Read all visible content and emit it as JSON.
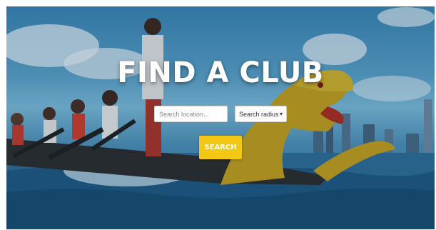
{
  "hero": {
    "title": "FIND A CLUB",
    "location_placeholder": "Search location...",
    "radius_selected": "Search radius",
    "search_label": "SEARCH"
  },
  "icons": {
    "select_arrow": "chevron-down-icon"
  },
  "colors": {
    "accent": "#f3c813",
    "title": "#ffffff",
    "water": "#2f6e9a"
  }
}
